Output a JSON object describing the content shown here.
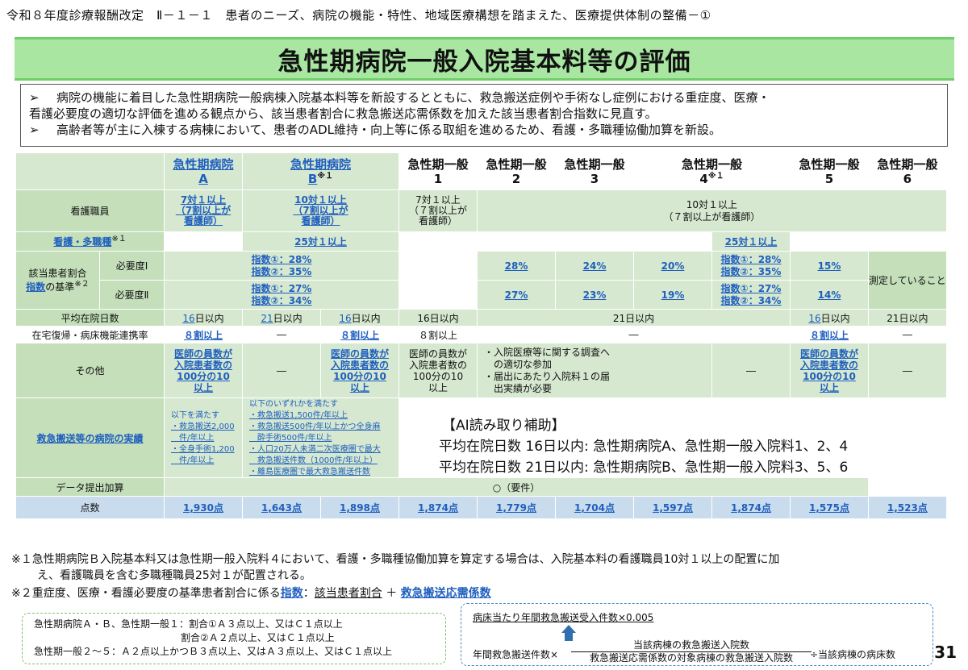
{
  "header": {
    "text": "令和８年度診療報酬改定　Ⅱ－１－１　患者のニーズ、病院の機能・特性、地域医療構想を踏まえた、医療提供体制の整備－①"
  },
  "title": "急性期病院一般入院基本料等の評価",
  "bullets": [
    {
      "marker": "➢",
      "line1": "病院の機能に着目した急性期病院一般病棟入院基本料等を新設するとともに、救急搬送症例や手術なし症例における重症度、医療・",
      "line2": "看護必要度の適切な評価を進める観点から、該当患者割合に救急搬送応需係数を加えた該当患者割合指数に見直す。"
    },
    {
      "marker": "➢",
      "line1": "高齢者等が主に入棟する病棟において、患者のADL維持・向上等に係る取組を進めるため、看護・多職種協働加算を新設。"
    }
  ],
  "table": {
    "columns": [
      {
        "l1": "急性期病院",
        "l2": "A",
        "sup": "",
        "link": true
      },
      {
        "l1": "急性期病院",
        "l2": "B",
        "sup": "※１",
        "link": true
      },
      {
        "l1": "急性期一般",
        "l2": "1",
        "sup": ""
      },
      {
        "l1": "急性期一般",
        "l2": "2",
        "sup": ""
      },
      {
        "l1": "急性期一般",
        "l2": "3",
        "sup": ""
      },
      {
        "l1": "急性期一般",
        "l2": "4",
        "sup": "※１"
      },
      {
        "l1": "急性期一般",
        "l2": "5",
        "sup": ""
      },
      {
        "l1": "急性期一般",
        "l2": "6",
        "sup": ""
      }
    ],
    "nurse": {
      "label": "看護職員",
      "a": [
        "7対１以上",
        "（7割以上が",
        "看護師）"
      ],
      "b": [
        "10対１以上",
        "（7割以上が",
        "看護師）"
      ],
      "g1": [
        "7対１以上",
        "（７割以上が",
        "看護師）"
      ],
      "g26": [
        "10対１以上",
        "（７割以上が看護師）"
      ]
    },
    "multi": {
      "label": "看護・多職種",
      "sup": "※１",
      "b": "25対１以上",
      "g4": "25対１以上"
    },
    "ratio": {
      "label1": "該当患者割合",
      "label2a": "指数",
      "label2b": "の基準",
      "sup": "※２",
      "need1": "必要度Ⅰ",
      "need2": "必要度Ⅱ",
      "ab1": [
        "指数①：28%",
        "指数②：35%"
      ],
      "ab2": [
        "指数①：27%",
        "指数②：34%"
      ],
      "g2": [
        "28%",
        "27%"
      ],
      "g3": [
        "24%",
        "23%"
      ],
      "g4": [
        "20%",
        "19%"
      ],
      "g5_1": [
        "指数①：28%",
        "指数②：35%"
      ],
      "g5_2": [
        "指数①：27%",
        "指数②：34%"
      ],
      "g6": [
        "15%",
        "14%"
      ],
      "g7": "測定していること"
    },
    "stay": {
      "label": "平均在院日数",
      "a": "16日以内",
      "a_u": "16",
      "b": "21日以内",
      "b_u": "21",
      "g1": "16日以内",
      "g1_u": "16",
      "g2": "16日以内",
      "mid": "21日以内",
      "g4": "16日以内",
      "g4_u": "16",
      "g56": "21日以内"
    },
    "home": {
      "label": "在宅復帰・病床機能連携率",
      "a": "８割以上",
      "b": "―",
      "g1": "８割以上",
      "g1b": "８割以上",
      "g23": "―",
      "g4": "８割以上",
      "g56": "―"
    },
    "other": {
      "label": "その他",
      "a": [
        "医師の員数が",
        "入院患者数の",
        "100分の10",
        "以上"
      ],
      "b": "―",
      "g1": [
        "医師の員数が",
        "入院患者数の",
        "100分の10",
        "以上"
      ],
      "g1b": [
        "医師の員数が",
        "入院患者数の",
        "100分の10",
        "以上"
      ],
      "g23": [
        "・入院医療等に関する調査へ",
        "　の適切な参加",
        "・届出にあたり入院料１の届",
        "　出実績が必要"
      ],
      "g3": "―",
      "g4": [
        "医師の員数が",
        "入院患者数の",
        "100分の10",
        "以上"
      ],
      "g56": "―"
    },
    "emerg": {
      "label": "救急搬送等の病院の実績",
      "a": [
        "以下を満たす",
        "・救急搬送2,000",
        "　件/年以上",
        "・全身手術1,200",
        "　件/年以上"
      ],
      "b": [
        "以下のいずれかを満たす",
        "・救急搬送1,500件/年以上",
        "・救急搬送500件/年以上かつ全身麻",
        "　酔手術500件/年以上",
        "・人口20万人未満二次医療圏で最大",
        "　救急搬送件数（1000件/年以上）",
        "・離島医療圏で最大救急搬送件数"
      ]
    },
    "data": {
      "label": "データ提出加算",
      "value": "○（要件）"
    },
    "points": {
      "label": "点数",
      "values": [
        "1,930点",
        "1,643点",
        "1,898点",
        "1,874点",
        "1,779点",
        "1,704点",
        "1,597点",
        "1,874点",
        "1,575点",
        "1,523点"
      ]
    }
  },
  "ai_note": {
    "heading": "【AI読み取り補助】",
    "line1": "平均在院日数 16日以内: 急性期病院A、急性期一般入院料1、2、4",
    "line2": "平均在院日数 21日以内: 急性期病院B、急性期一般入院料3、5、6"
  },
  "notes": {
    "n1a": "※１急性期病院Ｂ入院基本料又は急性期一般入院料４において、看護・多職種協働加算を算定する場合は、入院基本料の看護職員10対１以上の配置に加",
    "n1b": "え、看護職員を含む多職種職員25対１が配置される。",
    "n2a": "※２重症度、医療・看護必要度の基準患者割合に係る",
    "n2link": "指数",
    "n2b": "：",
    "n2c": "該当患者割合",
    "n2d": "＋",
    "n2e": "救急搬送応需係数"
  },
  "box1": {
    "l1": "急性期病院Ａ・Ｂ、急性期一般１：割合①Ａ３点以上、又はＣ１点以上",
    "l2": "割合②Ａ２点以上、又はＣ１点以上",
    "l3": "急性期一般２～５：Ａ２点以上かつＢ３点以上、又はＡ３点以上、又はＣ１点以上"
  },
  "box2": {
    "top": "病床当たり年間救急搬送受入件数×0.005",
    "left": "年間救急搬送件数×",
    "num": "当該病棟の救急搬送入院数",
    "den": "救急搬送応需係数の対象病棟の救急搬送入院数",
    "right": "÷当該病棟の病床数"
  },
  "page_number": "31",
  "colors": {
    "title_bg": "#a8e6a1",
    "cell_green": "#d6e8cf",
    "points_blue": "#c9dced",
    "link": "#1f5fbf"
  }
}
